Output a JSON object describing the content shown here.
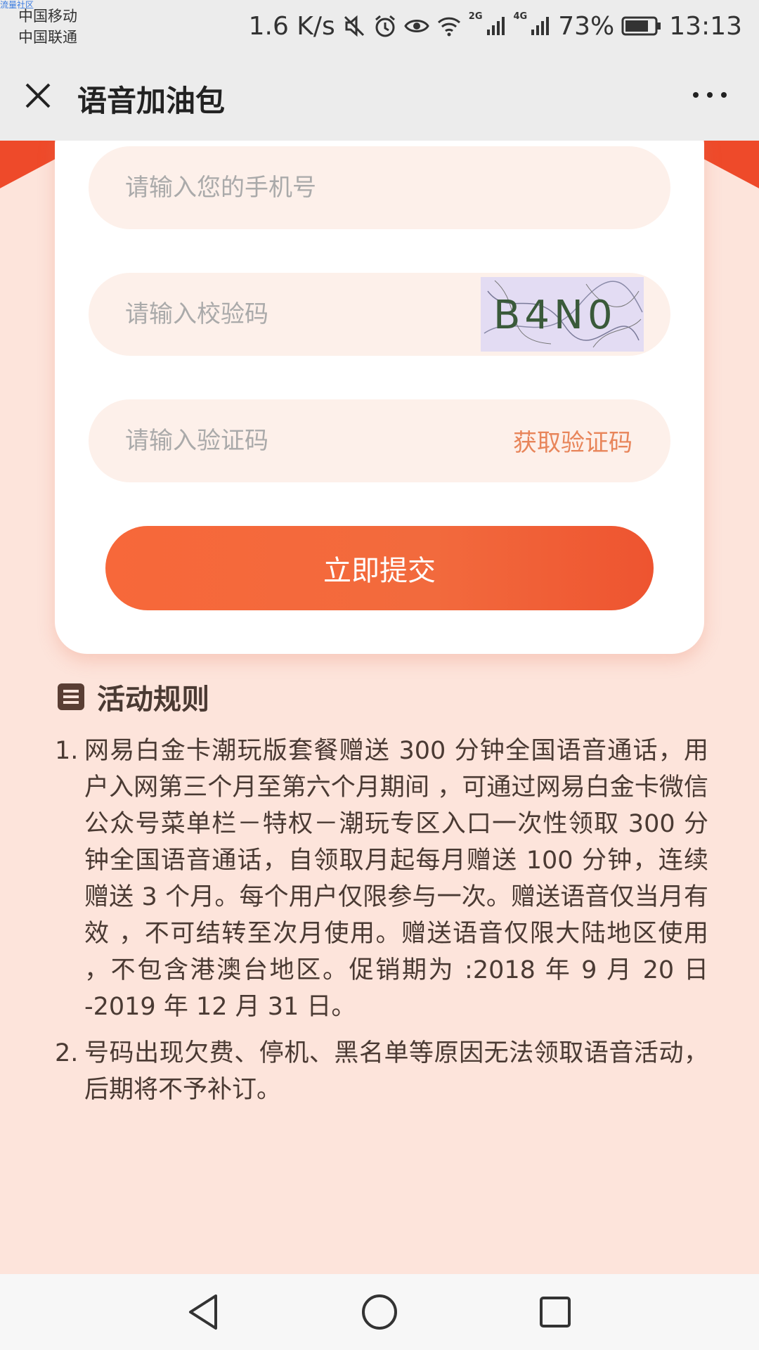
{
  "status_bar": {
    "watermark": "流量社区",
    "carrier_1": "中国移动",
    "carrier_2": "中国联通",
    "net_speed": "1.6 K/s",
    "net_tag_1": "2G",
    "net_tag_2": "4G",
    "battery": "73%",
    "time": "13:13"
  },
  "title_bar": {
    "title": "语音加油包"
  },
  "form": {
    "phone_placeholder": "请输入您的手机号",
    "captcha_placeholder": "请输入校验码",
    "captcha_text": "B4N0",
    "sms_placeholder": "请输入验证码",
    "get_code_label": "获取验证码",
    "submit_label": "立即提交"
  },
  "rules": {
    "title": "活动规则",
    "items": [
      {
        "num": "1.",
        "text": "网易白金卡潮玩版套餐赠送 300 分钟全国语音通话，用户入网第三个月至第六个月期间 ，可通过网易白金卡微信公众号菜单栏－特权－潮玩专区入口一次性领取 300 分钟全国语音通话，自领取月起每月赠送 100 分钟，连续赠送 3 个月。每个用户仅限参与一次。赠送语音仅当月有效 ，不可结转至次月使用。赠送语音仅限大陆地区使用 ，不包含港澳台地区。促销期为 :2018 年 9 月 20 日 -2019 年 12 月 31 日。"
      },
      {
        "num": "2.",
        "text": "号码出现欠费、停机、黑名单等原因无法领取语音活动，后期将不予补订。"
      }
    ]
  },
  "colors": {
    "accent": "#f26a3d",
    "page_bg": "#fde4db",
    "link": "#e8855a"
  },
  "icons": {
    "close": "close-icon",
    "more": "more-icon",
    "rules": "document-icon",
    "back": "back-triangle-icon",
    "home": "home-circle-icon",
    "recents": "recents-square-icon"
  }
}
